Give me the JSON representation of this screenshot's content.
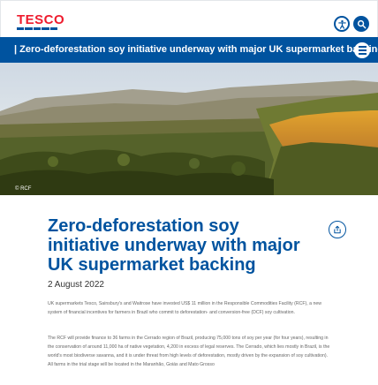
{
  "header": {
    "logo_text": "TESCO",
    "accessibility_button": "accessibility-icon",
    "search_button": "search-icon"
  },
  "titlebar": {
    "text": "| Zero-deforestation soy initiative underway with major UK supermarket backing",
    "menu_icon": "menu-icon"
  },
  "hero": {
    "credit": "© RCF"
  },
  "article": {
    "title": "Zero-deforestation soy initiative underway with major UK supermarket backing",
    "date": "2 August 2022",
    "share_icon": "share-icon",
    "paragraph_1": "UK supermarkets Tesco, Sainsbury's and Waitrose have invested US$ 11 million in the Responsible Commodities Facility (RCF), a new system of financial incentives for farmers in Brazil who commit to deforestation- and conversion-free (DCF) soy cultivation.",
    "paragraph_2": "The RCF will provide finance to 36 farms in the Cerrado region of Brazil, producing 75,000 tons of soy per year (for four years), resulting in the conservation of around 11,000 ha of native vegetation, 4,200 in excess of legal reserves. The Cerrado, which lies mostly in Brazil, is the world's most biodiverse savanna, and it is under threat from high levels of deforestation, mostly driven by the expansion of soy cultivation). All farms in the trial stage will be located in the Maranhão, Goiás and Mato Grosso"
  },
  "colors": {
    "brand_blue": "#00539f",
    "brand_red": "#ee1c2e"
  }
}
